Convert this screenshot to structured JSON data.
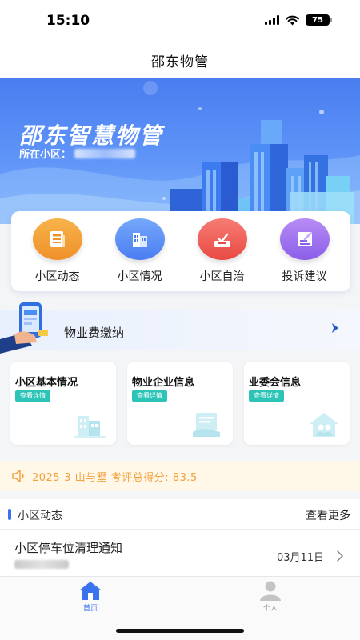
{
  "status": {
    "time": "15:10",
    "battery": "75"
  },
  "nav": {
    "title": "邵东物管"
  },
  "banner": {
    "title": "邵东智慧物管",
    "community_label": "所在小区："
  },
  "quick_actions": [
    {
      "label": "小区动态",
      "icon": "newspaper-icon",
      "color": "#f0902a"
    },
    {
      "label": "小区情况",
      "icon": "building-icon",
      "color": "#4a7df0"
    },
    {
      "label": "小区自治",
      "icon": "vote-box-icon",
      "color": "#e84a43"
    },
    {
      "label": "投诉建议",
      "icon": "edit-note-icon",
      "color": "#8b5ee8"
    }
  ],
  "fee": {
    "label": "物业费缴纳"
  },
  "info_cards": [
    {
      "title": "小区基本情况",
      "tag": "查看详情"
    },
    {
      "title": "物业企业信息",
      "tag": "查看详情"
    },
    {
      "title": "业委会信息",
      "tag": "查看详情"
    }
  ],
  "notice": {
    "text": "2025-3 山与墅 考评总得分: 83.5"
  },
  "news": {
    "section_title": "小区动态",
    "more_label": "查看更多",
    "items": [
      {
        "title": "小区停车位清理通知",
        "date": "03月11日"
      }
    ]
  },
  "tabs": [
    {
      "label": "首页",
      "active": true
    },
    {
      "label": "个人",
      "active": false
    }
  ],
  "colors": {
    "accent": "#3b72ee",
    "tag": "#2cc4b7",
    "notice_text": "#f2a13b"
  }
}
